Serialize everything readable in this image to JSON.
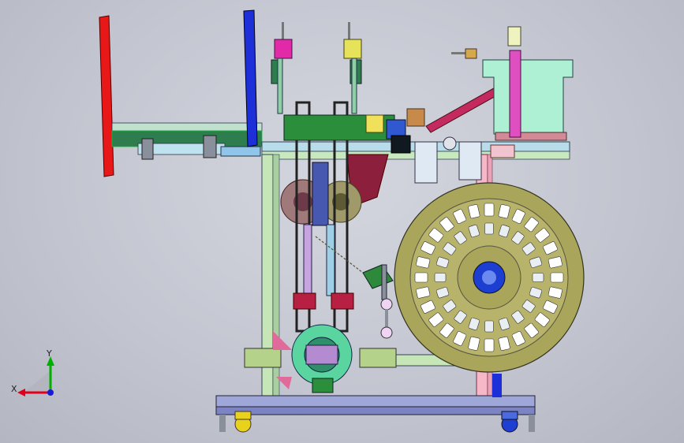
{
  "viewport": {
    "background_top": "#d4d6df",
    "background_bottom": "#b4b6c2"
  },
  "triad": {
    "x_label": "X",
    "y_label": "Y",
    "x_color": "#e0001b",
    "y_color": "#00b000",
    "z_color": "#1a1ad6"
  },
  "colors": {
    "frame_beam": "#b8dce9",
    "reel_disc": "#a9a55a",
    "red_bar": "#e81818",
    "blue_bar": "#1c2fd8",
    "pink_post": "#f6b7c8",
    "hopper": "#aef0d4",
    "base": "#9fa6d8"
  }
}
